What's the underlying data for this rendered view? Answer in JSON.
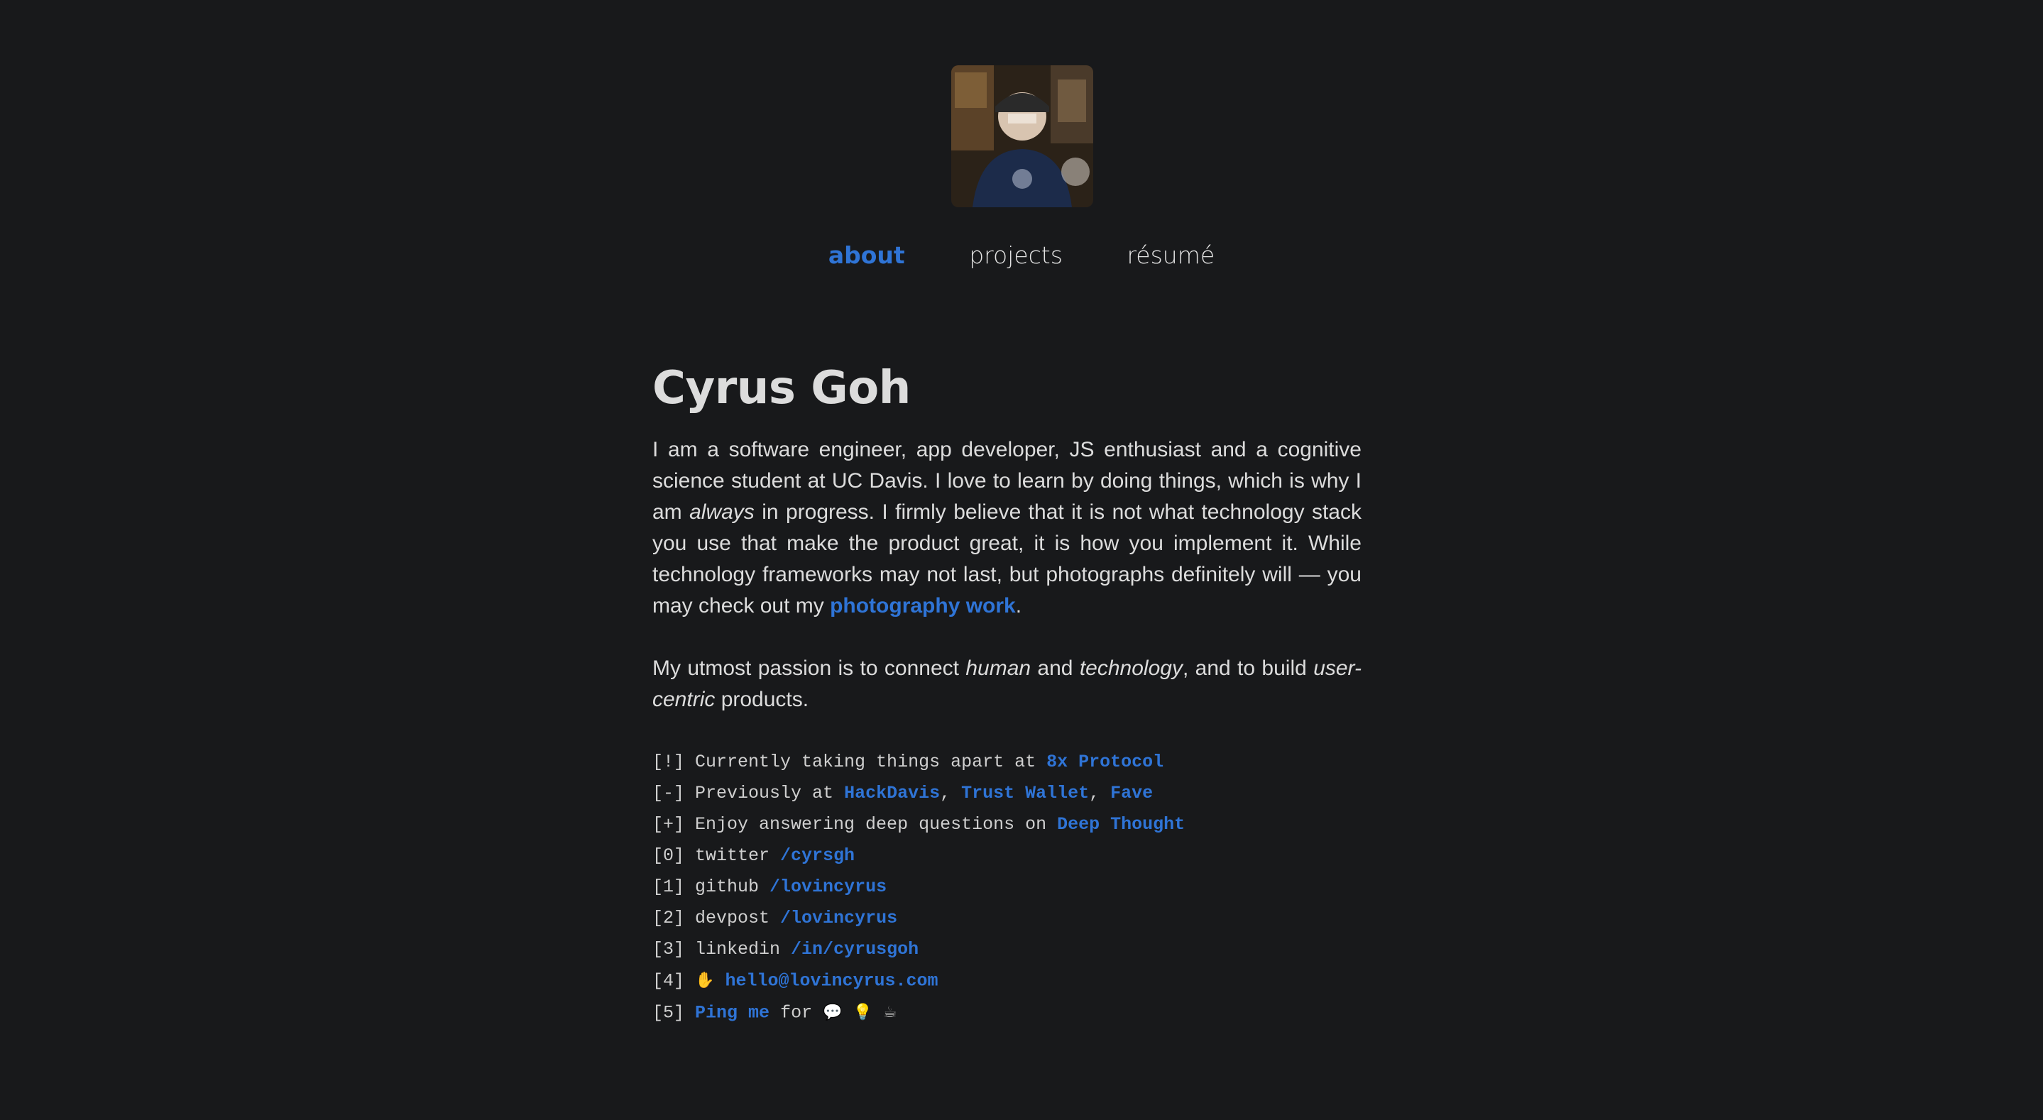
{
  "profile": {
    "avatar_alt": "Profile photo"
  },
  "nav": {
    "items": [
      {
        "label": "about",
        "active": true
      },
      {
        "label": "projects",
        "active": false
      },
      {
        "label": "résumé",
        "active": false
      }
    ]
  },
  "main": {
    "title": "Cyrus Goh",
    "para1": {
      "part1": "I am a software engineer, app developer, JS enthusiast and a cognitive science student at UC Davis. I love to learn by doing things, which is why I am ",
      "em1": "always",
      "part2": " in progress. I firmly believe that it is not what technology stack you use that make the product great, it is how you implement it. While technology frameworks may not last, but photographs definitely will — you may check out my ",
      "link": "photography work",
      "part3": "."
    },
    "para2": {
      "part1": "My utmost passion is to connect ",
      "em1": "human",
      "part2": " and ",
      "em2": "technology",
      "part3": ", and to build ",
      "em3": "user-centric",
      "part4": " products."
    }
  },
  "terminal": {
    "lines": [
      {
        "prefix": "[!]",
        "text": " Currently taking things apart at ",
        "links": [
          "8x Protocol"
        ]
      },
      {
        "prefix": "[-]",
        "text": " Previously at ",
        "links": [
          "HackDavis",
          "Trust Wallet",
          "Fave"
        ]
      },
      {
        "prefix": "[+]",
        "text": " Enjoy answering deep questions on ",
        "links": [
          "Deep Thought"
        ]
      },
      {
        "prefix": "[0]",
        "text": " twitter ",
        "links": [
          "/cyrsgh"
        ]
      },
      {
        "prefix": "[1]",
        "text": " github ",
        "links": [
          "/lovincyrus"
        ]
      },
      {
        "prefix": "[2]",
        "text": " devpost ",
        "links": [
          "/lovincyrus"
        ]
      },
      {
        "prefix": "[3]",
        "text": " linkedin ",
        "links": [
          "/in/cyrusgoh"
        ]
      },
      {
        "prefix": "[4]",
        "text": "",
        "links": [
          "hello@lovincyrus.com"
        ]
      },
      {
        "prefix": "[5]",
        "text": " for ",
        "links": [
          "Ping me"
        ]
      }
    ],
    "separator": ", "
  },
  "icons": {
    "handshake": "handshake-icon",
    "speech": "speech-bubble-icon",
    "bulb": "lightbulb-icon",
    "coffee": "coffee-icon"
  },
  "colors": {
    "background": "#18191b",
    "accent": "#2f74d6",
    "text": "#dcdcdc"
  }
}
